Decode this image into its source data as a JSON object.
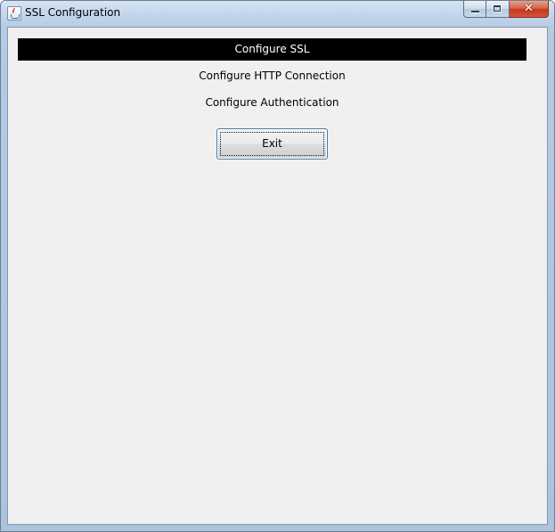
{
  "window": {
    "title": "SSL Configuration"
  },
  "menu": {
    "items": [
      {
        "label": "Configure SSL",
        "selected": true
      },
      {
        "label": "Configure HTTP Connection",
        "selected": false
      },
      {
        "label": "Configure Authentication",
        "selected": false
      }
    ]
  },
  "actions": {
    "exit_label": "Exit"
  },
  "icons": {
    "app": "java-icon",
    "minimize": "minimize-icon",
    "maximize": "maximize-icon",
    "close": "close-icon"
  },
  "colors": {
    "selected_background": "#000000",
    "selected_text": "#ffffff",
    "panel_background": "#f0f0f0",
    "close_button": "#c2381d"
  }
}
